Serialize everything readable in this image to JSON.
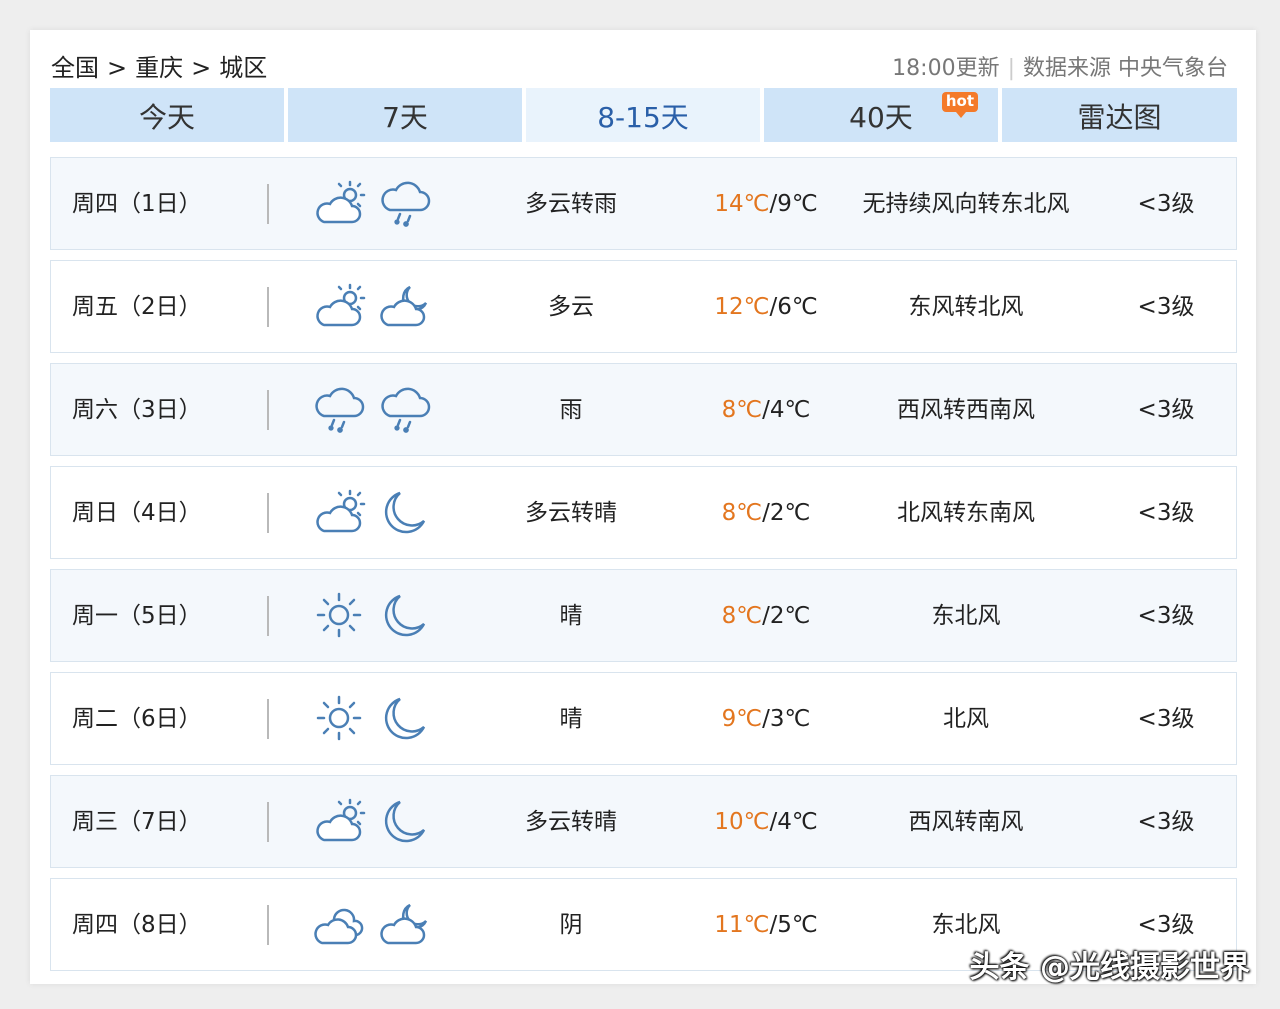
{
  "breadcrumb": {
    "country": "全国",
    "province": "重庆",
    "city": "城区",
    "separator": ">"
  },
  "meta": {
    "update": "18:00更新",
    "divider": "|",
    "source": "数据来源 中央气象台"
  },
  "tabs": [
    {
      "label": "今天"
    },
    {
      "label": "7天"
    },
    {
      "label": "8-15天",
      "active": true
    },
    {
      "label": "40天",
      "badge": "hot"
    },
    {
      "label": "雷达图"
    }
  ],
  "days": [
    {
      "day": "周四（1日）",
      "icon_day": "partly-cloudy-day-icon",
      "icon_night": "rain-icon",
      "desc": "多云转雨",
      "high": "14℃",
      "low": "9℃",
      "wind": "无持续风向转东北风",
      "level": "<3级"
    },
    {
      "day": "周五（2日）",
      "icon_day": "partly-cloudy-day-icon",
      "icon_night": "partly-cloudy-night-icon",
      "desc": "多云",
      "high": "12℃",
      "low": "6℃",
      "wind": "东风转北风",
      "level": "<3级"
    },
    {
      "day": "周六（3日）",
      "icon_day": "rain-icon",
      "icon_night": "rain-icon",
      "desc": "雨",
      "high": "8℃",
      "low": "4℃",
      "wind": "西风转西南风",
      "level": "<3级"
    },
    {
      "day": "周日（4日）",
      "icon_day": "partly-cloudy-day-icon",
      "icon_night": "moon-icon",
      "desc": "多云转晴",
      "high": "8℃",
      "low": "2℃",
      "wind": "北风转东南风",
      "level": "<3级"
    },
    {
      "day": "周一（5日）",
      "icon_day": "sun-icon",
      "icon_night": "moon-icon",
      "desc": "晴",
      "high": "8℃",
      "low": "2℃",
      "wind": "东北风",
      "level": "<3级"
    },
    {
      "day": "周二（6日）",
      "icon_day": "sun-icon",
      "icon_night": "moon-icon",
      "desc": "晴",
      "high": "9℃",
      "low": "3℃",
      "wind": "北风",
      "level": "<3级"
    },
    {
      "day": "周三（7日）",
      "icon_day": "partly-cloudy-day-icon",
      "icon_night": "moon-icon",
      "desc": "多云转晴",
      "high": "10℃",
      "low": "4℃",
      "wind": "西风转南风",
      "level": "<3级"
    },
    {
      "day": "周四（8日）",
      "icon_day": "overcast-icon",
      "icon_night": "partly-cloudy-night-icon",
      "desc": "阴",
      "high": "11℃",
      "low": "5℃",
      "wind": "东北风",
      "level": "<3级"
    }
  ],
  "watermark": "头条 @光线摄影世界",
  "colors": {
    "tab_bg": "#cfe4f8",
    "tab_active_bg": "#e9f3fc",
    "tab_active_text": "#2a5fa8",
    "high_temp": "#e3761f",
    "icon_stroke": "#4a7fb5",
    "hot_badge": "#f47a2a"
  }
}
